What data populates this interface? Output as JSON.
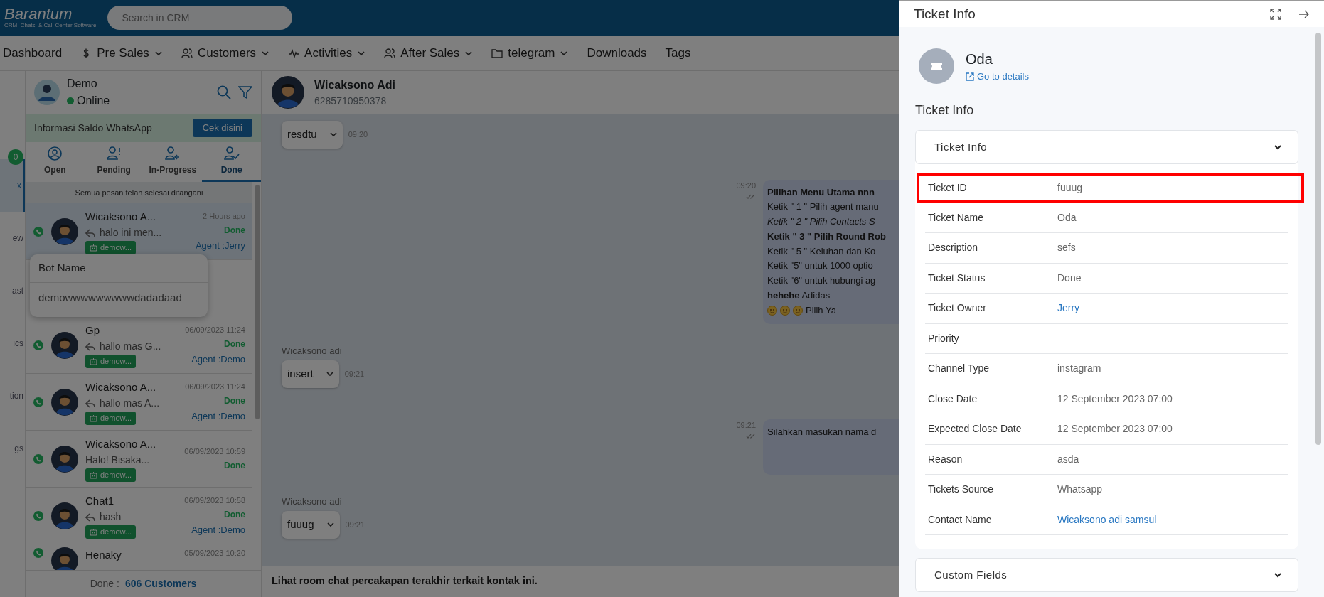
{
  "header": {
    "logo": "Barantum",
    "tagline": "CRM, Chats, & Call Center Software",
    "search_placeholder": "Search in CRM"
  },
  "nav": [
    {
      "label": "Dashboard",
      "dropdown": false
    },
    {
      "label": "Pre Sales",
      "dropdown": true
    },
    {
      "label": "Customers",
      "dropdown": true
    },
    {
      "label": "Activities",
      "dropdown": true
    },
    {
      "label": "After Sales",
      "dropdown": true
    },
    {
      "label": "telegram",
      "dropdown": true
    },
    {
      "label": "Downloads",
      "dropdown": false
    },
    {
      "label": "Tags",
      "dropdown": false
    }
  ],
  "rail": {
    "badge": "0",
    "items": [
      {
        "label": "x",
        "selected": true
      },
      {
        "label": "ew",
        "selected": false
      },
      {
        "label": "ast",
        "selected": false
      },
      {
        "label": "ics",
        "selected": false
      },
      {
        "label": "tion",
        "selected": false
      },
      {
        "label": "gs",
        "selected": false
      }
    ]
  },
  "chat_list": {
    "agent": {
      "name": "Demo",
      "status": "Online"
    },
    "banner": {
      "text": "Informasi Saldo WhatsApp",
      "button": "Cek disini"
    },
    "tabs": [
      {
        "label": "Open",
        "selected": false
      },
      {
        "label": "Pending",
        "selected": false
      },
      {
        "label": "In-Progress",
        "selected": false
      },
      {
        "label": "Done",
        "selected": true
      }
    ],
    "notice": "Semua pesan telah selesai ditangani",
    "conversations": [
      {
        "name": "Wicaksono A...",
        "preview": "halo ini men...",
        "replied": true,
        "bot": "demow...",
        "time": "2 Hours ago",
        "status": "Done",
        "agent": "Agent :Jerry",
        "selected": true
      },
      {
        "name": "Gp",
        "preview": "hallo mas G...",
        "replied": true,
        "bot": "demow...",
        "time": "06/09/2023 11:24",
        "status": "Done",
        "agent": "Agent :Demo",
        "selected": false
      },
      {
        "name": "Wicaksono A...",
        "preview": "hallo mas A...",
        "replied": true,
        "bot": "demow...",
        "time": "06/09/2023 11:24",
        "status": "Done",
        "agent": "Agent :Demo",
        "selected": false
      },
      {
        "name": "Wicaksono A...",
        "preview": "Halo! Bisaka...",
        "replied": false,
        "bot": "demow...",
        "time": "06/09/2023 10:59",
        "status": "Done",
        "selected": false
      },
      {
        "name": "Chat1",
        "preview": "hash",
        "replied": true,
        "bot": "demow...",
        "time": "06/09/2023 10:58",
        "status": "Done",
        "agent": "Agent :Demo",
        "selected": false
      },
      {
        "name": "Henaky",
        "time": "05/09/2023 10:20",
        "selected": false
      }
    ],
    "popover": {
      "title": "Bot Name",
      "value": "demowwwwwwwwwdadadaad"
    },
    "footer": {
      "label": "Done :",
      "count": "606 Customers"
    }
  },
  "chat": {
    "contact": {
      "name": "Wicaksono Adi",
      "phone": "6285710950378"
    },
    "messages": [
      {
        "kind": "incoming",
        "value": "resdtu",
        "time": "09:20"
      },
      {
        "kind": "outgoing",
        "time": "09:20",
        "lines": [
          {
            "text": "**Pilihan Menu Utama nnn**"
          },
          {
            "text": "Ketik \" 1 \" Pilih agent manu"
          },
          {
            "text": "*Ketik \" 2 \" Pilih Contacts S*"
          },
          {
            "text": "**Ketik \" 3 \" Pilih Round Rob**"
          },
          {
            "text": "Ketik \" 5 \" Keluhan dan Ko"
          },
          {
            "text": "Ketik \"5\" untuk 1000 optio"
          },
          {
            "text": "Ketik \"6\" untuk hubungi ag"
          },
          {
            "text": "**hehehe** Adidas"
          },
          {
            "text": "Pilih Ya",
            "kind": "emoji"
          }
        ]
      },
      {
        "kind": "incoming",
        "sender": "Wicaksono adi",
        "value": "insert",
        "time": "09:21"
      },
      {
        "kind": "outgoing",
        "time": "09:21",
        "lines": [
          {
            "text": "Silahkan masukan nama d"
          }
        ]
      },
      {
        "kind": "incoming",
        "sender": "Wicaksono adi",
        "value": "fuuug",
        "time": "09:21"
      }
    ],
    "footer": "Lihat room chat percakapan terakhir terkait kontak ini."
  },
  "drawer": {
    "title": "Ticket Info",
    "name": "Oda",
    "link": "Go to details",
    "heading": "Ticket Info",
    "sections": [
      {
        "title": "Ticket Info",
        "rows": [
          {
            "label": "Ticket ID",
            "value": "fuuug",
            "highlighted": true
          },
          {
            "label": "Ticket Name",
            "value": "Oda",
            "highlighted": false
          },
          {
            "label": "Description",
            "value": "sefs",
            "highlighted": false
          },
          {
            "label": "Ticket Status",
            "value": "Done",
            "highlighted": false
          },
          {
            "label": "Ticket Owner",
            "value": "Jerry",
            "linked": true,
            "highlighted": false
          },
          {
            "label": "Priority",
            "highlighted": false
          },
          {
            "label": "Channel Type",
            "value": "instagram",
            "highlighted": false
          },
          {
            "label": "Close Date",
            "value": "12 September 2023 07:00",
            "highlighted": false
          },
          {
            "label": "Expected Close Date",
            "value": "12 September 2023 07:00",
            "highlighted": false
          },
          {
            "label": "Reason",
            "value": "asda",
            "highlighted": false
          },
          {
            "label": "Tickets Source",
            "value": "Whatsapp",
            "highlighted": false
          },
          {
            "label": "Contact Name",
            "value": "Wicaksono adi samsul",
            "linked": true,
            "highlighted": false
          }
        ]
      },
      {
        "title": "Custom Fields"
      }
    ]
  }
}
